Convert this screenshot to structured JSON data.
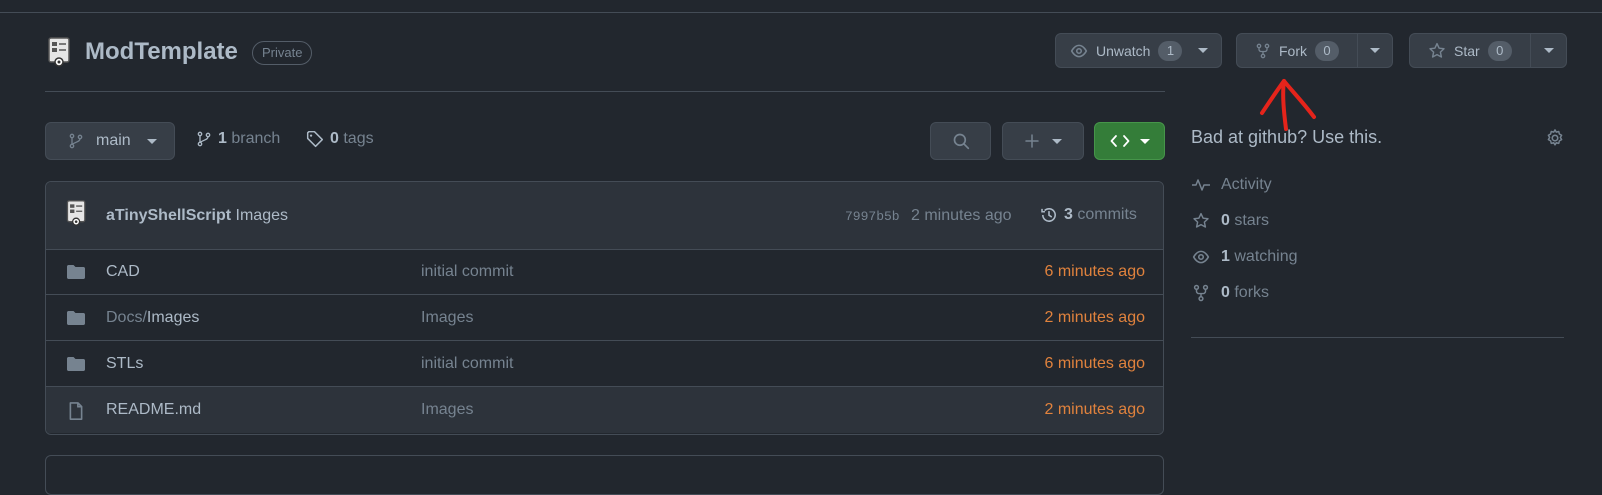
{
  "repo": {
    "name": "ModTemplate",
    "visibility": "Private"
  },
  "actions": {
    "watch": {
      "label": "Unwatch",
      "count": "1"
    },
    "fork": {
      "label": "Fork",
      "count": "0"
    },
    "star": {
      "label": "Star",
      "count": "0"
    }
  },
  "toolbar": {
    "branch": "main",
    "branch_count": "1",
    "branch_word": "branch",
    "tag_count": "0",
    "tag_word": "tags"
  },
  "latest_commit": {
    "author": "aTinyShellScript",
    "message": "Images",
    "sha": "7997b5b",
    "time": "2 minutes ago",
    "commit_count": "3",
    "commit_word": "commits"
  },
  "files": [
    {
      "type": "folder",
      "name": "CAD",
      "msg": "initial commit",
      "age": "6 minutes ago"
    },
    {
      "type": "folder",
      "name_prefix": "Docs/",
      "name": "Images",
      "msg": "Images",
      "age": "2 minutes ago"
    },
    {
      "type": "folder",
      "name": "STLs",
      "msg": "initial commit",
      "age": "6 minutes ago"
    },
    {
      "type": "file",
      "name": "README.md",
      "msg": "Images",
      "age": "2 minutes ago"
    }
  ],
  "about": {
    "description": "Bad at github? Use this.",
    "activity": "Activity",
    "stars_count": "0",
    "stars_word": "stars",
    "watching_count": "1",
    "watching_word": "watching",
    "forks_count": "0",
    "forks_word": "forks"
  },
  "colors": {
    "background": "#22272e",
    "accent_green": "#347d39",
    "age_orange": "#e0823d",
    "annotation_red": "#e5241b"
  },
  "icons": [
    "repo-avatar-icon",
    "eye-icon",
    "fork-icon",
    "star-icon",
    "branch-icon",
    "tag-icon",
    "search-icon",
    "plus-icon",
    "code-icon",
    "history-icon",
    "folder-icon",
    "file-icon",
    "gear-icon",
    "pulse-icon"
  ]
}
